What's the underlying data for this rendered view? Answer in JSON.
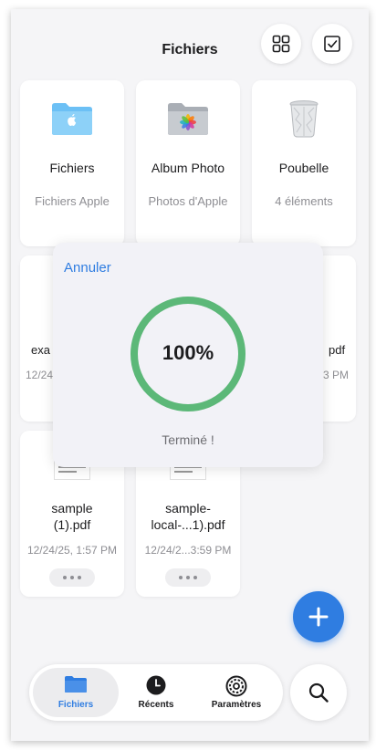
{
  "header": {
    "title": "Fichiers"
  },
  "locations": [
    {
      "title": "Fichiers",
      "subtitle": "Fichiers Apple",
      "icon": "folder-apple-icon"
    },
    {
      "title": "Album Photo",
      "subtitle": "Photos d'Apple",
      "icon": "folder-photos-icon"
    },
    {
      "title": "Poubelle",
      "subtitle": "4 éléments",
      "icon": "trash-icon"
    }
  ],
  "partial_files": {
    "left_name": "exa",
    "left_date": "12/24",
    "right_name": "pdf",
    "right_date": "3 PM"
  },
  "files": [
    {
      "name": "sample\n(1).pdf",
      "date": "12/24/25, 1:57 PM"
    },
    {
      "name": "sample-\nlocal-...1).pdf",
      "date": "12/24/2...3:59 PM"
    }
  ],
  "progress_dialog": {
    "cancel_label": "Annuler",
    "percent_text": "100%",
    "progress": 1.0,
    "status": "Terminé !",
    "ring_color": "#5cb878"
  },
  "tabs": [
    {
      "label": "Fichiers",
      "icon": "folder-icon",
      "active": true
    },
    {
      "label": "Récents",
      "icon": "clock-icon",
      "active": false
    },
    {
      "label": "Paramètres",
      "icon": "gear-icon",
      "active": false
    }
  ],
  "colors": {
    "accent": "#2f7de1",
    "progress": "#5cb878"
  }
}
